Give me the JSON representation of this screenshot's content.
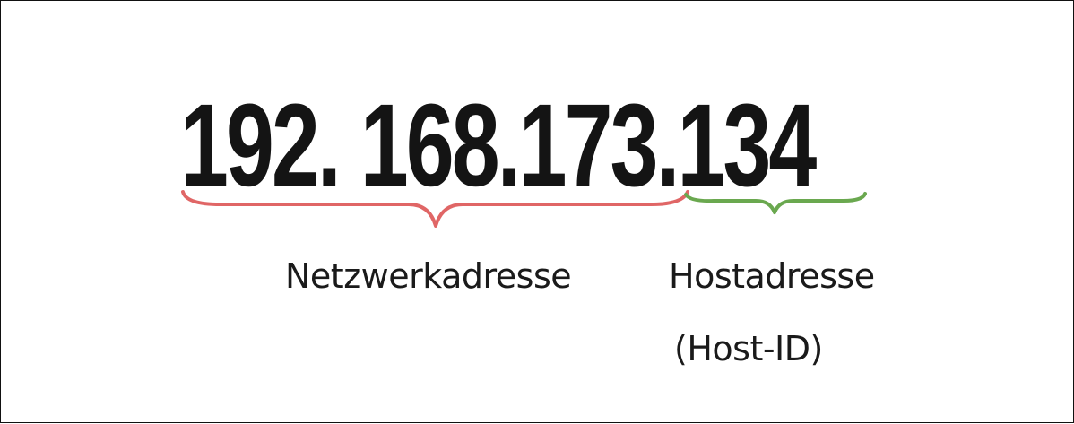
{
  "ip": {
    "address": "192. 168.173.134"
  },
  "labels": {
    "network": "Netzwerkadresse",
    "host": "Hostadresse",
    "host_id": "(Host-ID)"
  },
  "colors": {
    "network_brace": "#e06666",
    "host_brace": "#6aa84f",
    "text": "#141414"
  }
}
